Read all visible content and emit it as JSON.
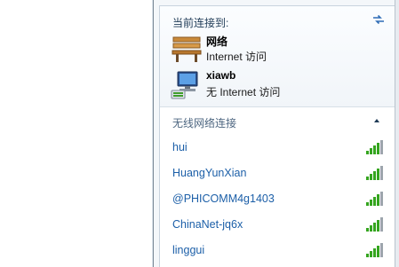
{
  "flyout": {
    "current_header": "当前连接到:",
    "connections": [
      {
        "name": "网络",
        "status": "Internet 访问",
        "icon": "bench-network-icon"
      },
      {
        "name": "xiawb",
        "status": "无 Internet 访问",
        "icon": "computer-network-icon"
      }
    ],
    "wireless_section_title": "无线网络连接",
    "networks": [
      {
        "name": "hui",
        "signal": 4
      },
      {
        "name": "HuangYunXian",
        "signal": 4
      },
      {
        "name": "@PHICOMM4g1403",
        "signal": 4
      },
      {
        "name": "ChinaNet-jq6x",
        "signal": 4
      },
      {
        "name": "linggui",
        "signal": 4
      }
    ],
    "colors": {
      "link": "#1c5fa8",
      "signal_green": "#35a51f",
      "signal_gray": "#9da5ad"
    }
  }
}
